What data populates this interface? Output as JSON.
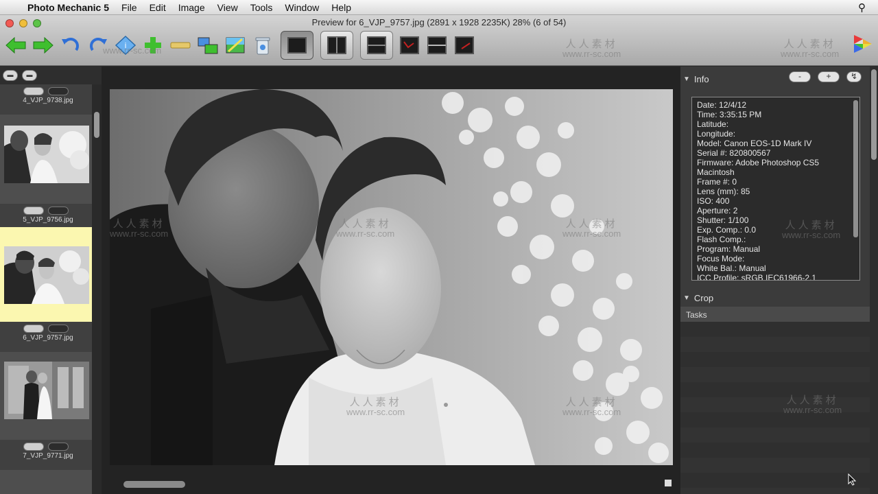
{
  "menubar": {
    "app_name": "Photo Mechanic 5",
    "items": [
      "File",
      "Edit",
      "Image",
      "View",
      "Tools",
      "Window",
      "Help"
    ]
  },
  "window": {
    "title": "Preview for 6_VJP_9757.jpg (2891 x 1928 2235K) 28% (6 of 54)"
  },
  "toolbar": {
    "icons": [
      "back-arrow-icon",
      "forward-arrow-icon",
      "rotate-left-icon",
      "rotate-right-icon",
      "diamond-icon",
      "add-icon",
      "minus-icon",
      "compare-icon",
      "edit-image-icon",
      "trash-icon"
    ],
    "view_modes": [
      "single-view",
      "split-view-vertical",
      "split-view-horizontal",
      "loupe-view",
      "compare-view",
      "crop-view"
    ]
  },
  "watermark": {
    "cn": "人人素材",
    "url": "www.rr-sc.com"
  },
  "strip": {
    "cells": [
      {
        "name": "4_VJP_9738.jpg",
        "selected": false
      },
      {
        "name": "5_VJP_9756.jpg",
        "selected": false
      },
      {
        "name": "6_VJP_9757.jpg",
        "selected": true
      },
      {
        "name": "7_VJP_9771.jpg",
        "selected": false
      }
    ]
  },
  "info": {
    "title": "Info",
    "minus": "-",
    "plus": "+",
    "lines": [
      "Date: 12/4/12",
      "Time: 3:35:15 PM",
      "Latitude:",
      "Longitude:",
      "Model: Canon EOS-1D Mark IV",
      "Serial #: 820800567",
      "Firmware: Adobe Photoshop CS5",
      "Macintosh",
      "Frame #: 0",
      "Lens (mm): 85",
      "ISO: 400",
      "Aperture: 2",
      "Shutter: 1/100",
      "Exp. Comp.: 0.0",
      "Flash Comp.:",
      "Program: Manual",
      "Focus Mode:",
      "White Bal.: Manual",
      "ICC Profile: sRGB IEC61966-2.1"
    ]
  },
  "crop": {
    "title": "Crop"
  },
  "tasks": {
    "title": "Tasks"
  }
}
